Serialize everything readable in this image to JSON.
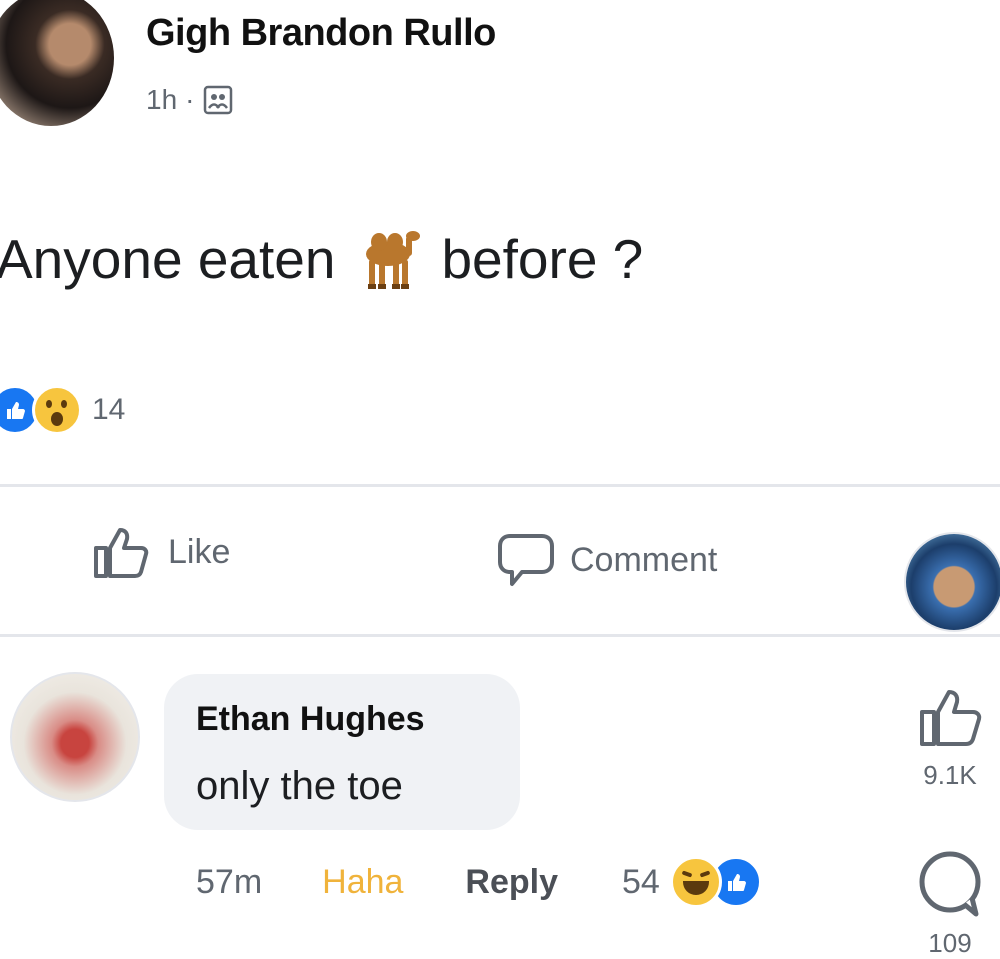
{
  "post": {
    "author_name": "Gigh Brandon Rullo",
    "time": "1h",
    "separator": "·",
    "audience_icon": "group-icon",
    "text_before": "Anyone eaten",
    "emoji": "camel-icon",
    "text_after": "before ?",
    "reactions": {
      "types": [
        "like-icon",
        "wow-icon"
      ],
      "count": "14"
    }
  },
  "actions": {
    "like_label": "Like",
    "comment_label": "Comment"
  },
  "comment": {
    "author_name": "Ethan Hughes",
    "text": "only the toe",
    "time": "57m",
    "reaction_label": "Haha",
    "reply_label": "Reply",
    "reaction_count": "54",
    "reactions": [
      "haha-icon",
      "like-icon"
    ]
  },
  "side_rail": {
    "like_count": "9.1K",
    "comment_count": "109"
  },
  "colors": {
    "like_blue": "#1877f2",
    "haha_yellow": "#f7c53e",
    "muted_text": "#606770",
    "bubble_bg": "#f0f2f5",
    "divider": "#e4e6eb"
  }
}
